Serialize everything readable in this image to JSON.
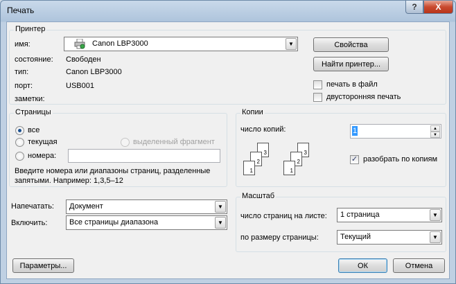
{
  "window": {
    "title": "Печать",
    "help_glyph": "?",
    "close_glyph": "X"
  },
  "printer": {
    "group_title": "Принтер",
    "name_label": "имя:",
    "name_value": "Canon LBP3000",
    "status_label": "состояние:",
    "status_value": "Свободен",
    "type_label": "тип:",
    "type_value": "Canon LBP3000",
    "port_label": "порт:",
    "port_value": "USB001",
    "notes_label": "заметки:",
    "properties_button": "Свойства",
    "find_button": "Найти принтер...",
    "print_to_file_label": "печать в файл",
    "print_to_file_checked": false,
    "duplex_label": "двусторонняя печать",
    "duplex_checked": false
  },
  "pages": {
    "group_title": "Страницы",
    "all_label": "все",
    "current_label": "текущая",
    "selection_label": "выделенный фрагмент",
    "numbers_label": "номера:",
    "numbers_value": "",
    "selected": "all",
    "hint": "Введите номера или диапазоны страниц, разделенные запятыми. Например: 1,3,5–12"
  },
  "copies": {
    "group_title": "Копии",
    "count_label": "число копий:",
    "count_value": "1",
    "collate_label": "разобрать по копиям",
    "collate_checked": true,
    "stack_pages": [
      "1",
      "2",
      "3"
    ]
  },
  "print_what": {
    "label": "Напечатать:",
    "value": "Документ",
    "include_label": "Включить:",
    "include_value": "Все страницы диапазона"
  },
  "zoom": {
    "group_title": "Масштаб",
    "pages_per_sheet_label": "число страниц на листе:",
    "pages_per_sheet_value": "1 страница",
    "scale_label": "по размеру страницы:",
    "scale_value": "Текущий"
  },
  "footer": {
    "options_button": "Параметры...",
    "ok_button": "ОК",
    "cancel_button": "Отмена"
  },
  "icons": {
    "combo_arrow": "▼",
    "spin_up": "▲",
    "spin_down": "▼",
    "check": "✓"
  }
}
